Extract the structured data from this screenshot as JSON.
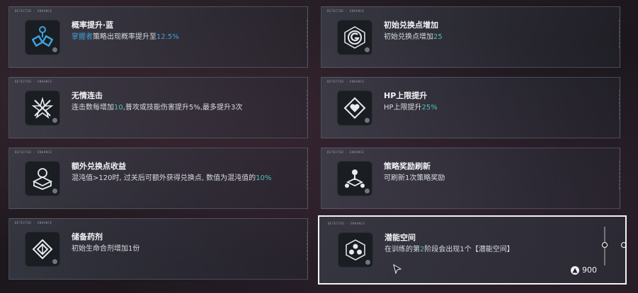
{
  "cards": [
    {
      "tag": "DETECTED · ENHANCE",
      "title": "概率提升·蓝",
      "desc_pre": "",
      "desc_hl": "掌握者",
      "desc_mid": "策略出现概率提升至",
      "desc_val": "12.5%",
      "desc_post": "",
      "icon": "molecule-icon",
      "accent": "#3ea1d8"
    },
    {
      "tag": "DETECTED · ENHANCE",
      "title": "初始兑换点增加",
      "desc_pre": "初始兑换点增加",
      "desc_hl": "",
      "desc_mid": "",
      "desc_val": "25",
      "desc_post": "",
      "icon": "g-coin-icon",
      "accent": "#4ec2b8"
    },
    {
      "tag": "DETECTED · ENHANCE",
      "title": "无情连击",
      "desc_pre": "连击数每增加",
      "desc_hl": "",
      "desc_mid": "",
      "desc_val": "10",
      "desc_post": ",普攻或技能伤害提升5%,最多提升3次",
      "icon": "crossed-stars-icon",
      "accent": "#4ec2b8"
    },
    {
      "tag": "DETECTED · ENHANCE",
      "title": "HP上限提升",
      "desc_pre": "HP上限提升",
      "desc_hl": "",
      "desc_mid": "",
      "desc_val": "25%",
      "desc_post": "",
      "icon": "heart-diamond-icon",
      "accent": "#4ec2b8"
    },
    {
      "tag": "DETECTED · ENHANCE",
      "title": "额外兑换点收益",
      "desc_pre": "混沌值>120时, 过关后可额外获得兑换点, 数值为混沌值的",
      "desc_hl": "",
      "desc_mid": "",
      "desc_val": "10%",
      "desc_post": "",
      "icon": "box-coin-icon",
      "accent": "#4ec2b8"
    },
    {
      "tag": "DETECTED · ENHANCE",
      "title": "策略奖励刷新",
      "desc_pre": "可刷新1次策略奖励",
      "desc_hl": "",
      "desc_mid": "",
      "desc_val": "",
      "desc_post": "",
      "icon": "network-icon",
      "accent": "#4ec2b8"
    },
    {
      "tag": "DETECTED · ENHANCE",
      "title": "储备药剂",
      "desc_pre": "初始生命合剂增加1份",
      "desc_hl": "",
      "desc_mid": "",
      "desc_val": "",
      "desc_post": "",
      "icon": "potion-icon",
      "accent": "#4ec2b8"
    },
    {
      "tag": "DETECTED · ENHANCE",
      "title": "潜能空间",
      "desc_pre": "在训练的第",
      "desc_hl": "",
      "desc_mid": "",
      "desc_val": "2",
      "desc_post": "阶段会出现1个【潜能空间】",
      "icon": "hex-cluster-icon",
      "accent": "#4ec2b8"
    }
  ],
  "selected": {
    "cost": "900"
  }
}
